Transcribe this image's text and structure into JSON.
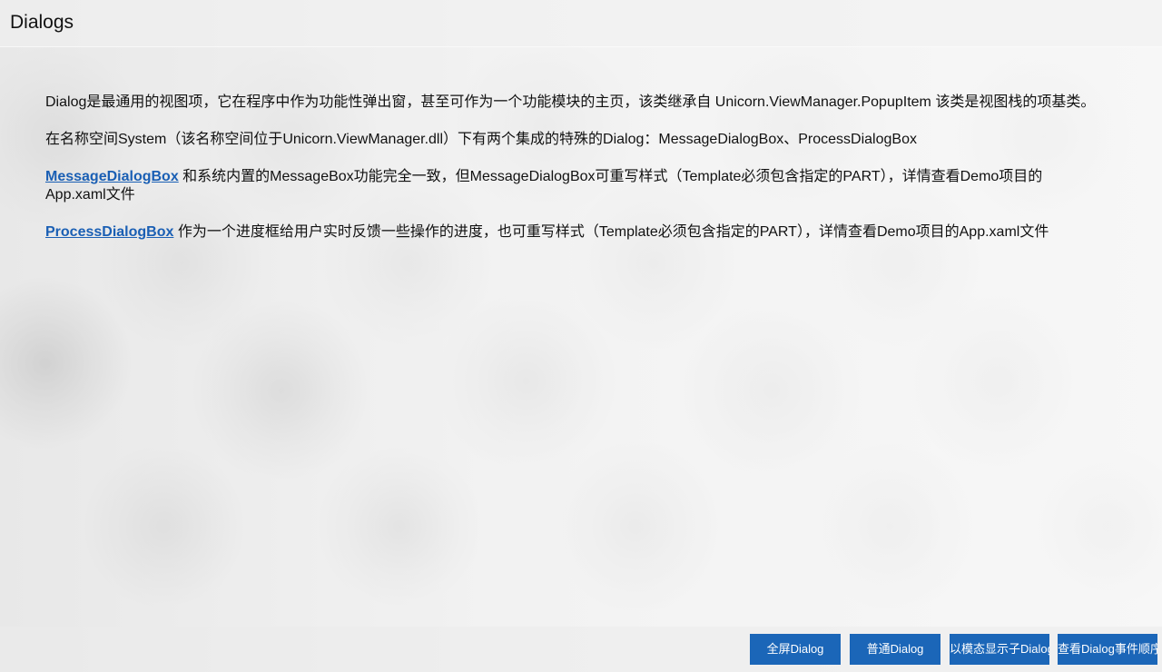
{
  "window": {
    "title": "Dialogs"
  },
  "content": {
    "paragraph1": "Dialog是最通用的视图项，它在程序中作为功能性弹出窗，甚至可作为一个功能模块的主页，该类继承自 Unicorn.ViewManager.PopupItem 该类是视图栈的项基类。",
    "paragraph2": "在名称空间System（该名称空间位于Unicorn.ViewManager.dll）下有两个集成的特殊的Dialog：MessageDialogBox、ProcessDialogBox",
    "message_link": "MessageDialogBox",
    "paragraph3_text": " 和系统内置的MessageBox功能完全一致，但MessageDialogBox可重写样式（Template必须包含指定的PART），详情查看Demo项目的App.xaml文件",
    "process_link": "ProcessDialogBox",
    "paragraph4_text": " 作为一个进度框给用户实时反馈一些操作的进度，也可重写样式（Template必须包含指定的PART），详情查看Demo项目的App.xaml文件"
  },
  "footer": {
    "buttons": [
      "全屏Dialog",
      "普通Dialog",
      "以模态显示子Dialog",
      "查看Dialog事件顺序"
    ]
  },
  "colors": {
    "accent": "#1b66b8",
    "link": "#1a5fb4"
  }
}
